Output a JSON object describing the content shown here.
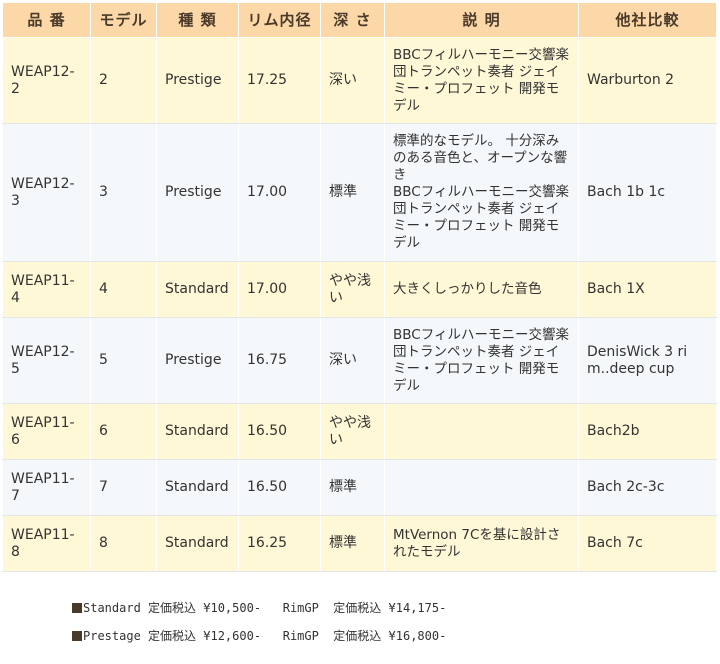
{
  "table": {
    "headers": [
      "品 番",
      "モデル",
      "種 類",
      "リム内径",
      "深 さ",
      "説 明",
      "他社比較"
    ],
    "rows": [
      {
        "code": "WEAP12-2",
        "model": "2",
        "type": "Prestige",
        "rim": "17.25",
        "depth": "深い",
        "desc": "BBCフィルハーモニー交響楽団トランペット奏者 ジェイミー・プロフェット 開発モデル",
        "compare": "Warburton 2"
      },
      {
        "code": "WEAP12-3",
        "model": "3",
        "type": "Prestige",
        "rim": "17.00",
        "depth": "標準",
        "desc": "標準的なモデル。 十分深みのある音色と、オープンな響き",
        "desc2": "BBCフィルハーモニー交響楽団トランペット奏者 ジェイミー・プロフェット 開発モデル",
        "compare": "Bach 1b 1c"
      },
      {
        "code": "WEAP11-4",
        "model": "4",
        "type": "Standard",
        "rim": "17.00",
        "depth": "やや浅い",
        "desc": "大きくしっかりした音色",
        "compare": "Bach 1X"
      },
      {
        "code": "WEAP12-5",
        "model": "5",
        "type": "Prestige",
        "rim": "16.75",
        "depth": "深い",
        "desc": "BBCフィルハーモニー交響楽団トランペット奏者 ジェイミー・プロフェット 開発モデル",
        "compare": "DenisWick 3 rim..deep cup"
      },
      {
        "code": "WEAP11-6",
        "model": "6",
        "type": "Standard",
        "rim": "16.50",
        "depth": "やや浅い",
        "desc": "",
        "compare": "Bach2b"
      },
      {
        "code": "WEAP11-7",
        "model": "7",
        "type": "Standard",
        "rim": "16.50",
        "depth": "標準",
        "desc": "",
        "compare": "Bach 2c-3c"
      },
      {
        "code": "WEAP11-8",
        "model": "8",
        "type": "Standard",
        "rim": "16.25",
        "depth": "標準",
        "desc": "MtVernon 7Cを基に設計されたモデル",
        "compare": "Bach 7c"
      }
    ]
  },
  "prices": [
    {
      "label": "Standard 定価税込 ¥10,500-   RimGP  定価税込 ¥14,175-"
    },
    {
      "label": "Prestage 定価税込 ¥12,600-   RimGP  定価税込 ¥16,800-"
    }
  ],
  "colors": {
    "header_bg": "#fcd8a8",
    "odd_row_bg": "#fff8d6",
    "even_row_bg": "#f4f8fb",
    "bullet": "#4a3a2a"
  }
}
